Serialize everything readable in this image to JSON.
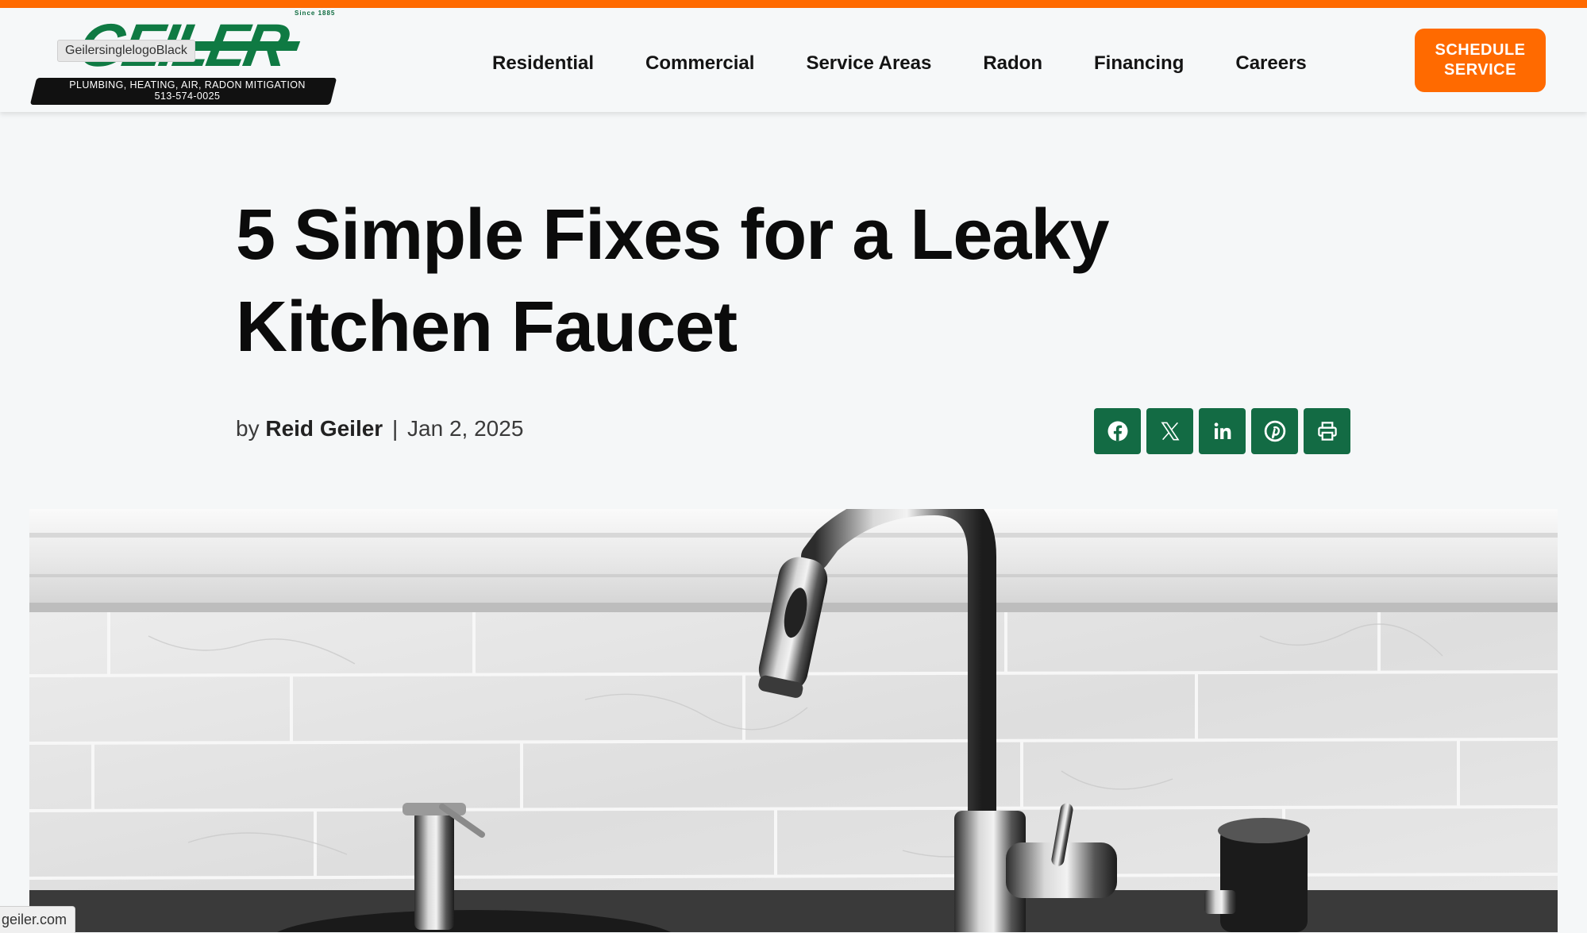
{
  "header": {
    "logo": {
      "since": "Since 1885",
      "wordmark": "GEILER",
      "tagline": "PLUMBING, HEATING, AIR, RADON MITIGATION",
      "phone": "513-574-0025",
      "tooltip": "GeilersinglelogoBlack"
    },
    "nav": [
      {
        "label": "Residential"
      },
      {
        "label": "Commercial"
      },
      {
        "label": "Service Areas"
      },
      {
        "label": "Radon"
      },
      {
        "label": "Financing"
      },
      {
        "label": "Careers"
      }
    ],
    "cta_label": "SCHEDULE\nSERVICE"
  },
  "article": {
    "title_line1": "5 Simple Fixes for a Leaky",
    "title_line2": "Kitchen Faucet",
    "by": "by",
    "author": "Reid Geiler",
    "separator": "|",
    "date": "Jan 2, 2025"
  },
  "share": [
    {
      "icon": "facebook-icon"
    },
    {
      "icon": "x-icon"
    },
    {
      "icon": "linkedin-icon"
    },
    {
      "icon": "pinterest-icon"
    },
    {
      "icon": "print-icon"
    }
  ],
  "status_bar": {
    "url": "geiler.com"
  },
  "colors": {
    "accent_orange": "#ff6a00",
    "brand_green": "#136b44",
    "background": "#f5f7f8"
  }
}
